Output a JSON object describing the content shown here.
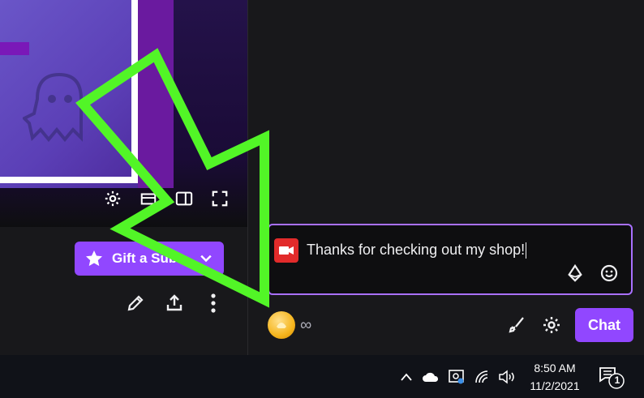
{
  "player": {
    "controls": [
      "gear-icon",
      "clip-icon",
      "theatre-mode-icon",
      "fullscreen-icon"
    ]
  },
  "gift": {
    "label": "Gift a Sub"
  },
  "actions": [
    "pencil-icon",
    "share-icon",
    "more-vertical-icon"
  ],
  "chat": {
    "input_text": "Thanks for checking out my shop!",
    "points_count": "∞",
    "send_label": "Chat",
    "accent": "#9147ff"
  },
  "taskbar": {
    "time": "8:50 AM",
    "date": "11/2/2021",
    "notification_count": "1"
  }
}
